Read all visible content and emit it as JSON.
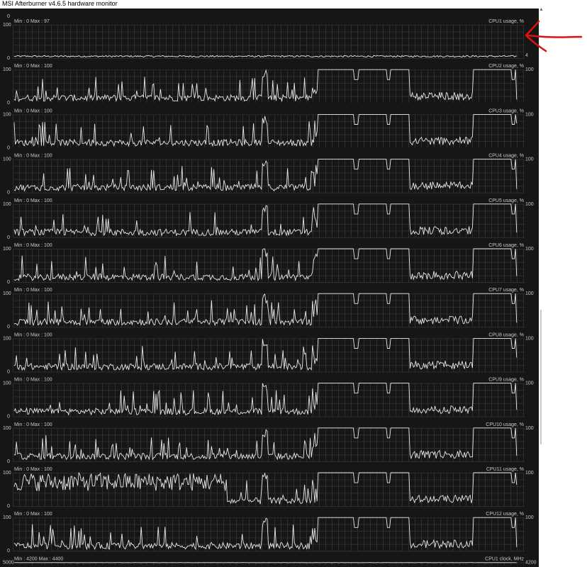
{
  "window": {
    "title": "MSI Afterburner v4.6.5 hardware monitor"
  },
  "colors": {
    "background": "#161616",
    "grid": "#2e2e2e",
    "trace": "#e8e8e8",
    "text": "#c8c8c8",
    "annotation": "#e01010"
  },
  "graphs": [
    {
      "name": "CPU1 usage, %",
      "scale_top": "100",
      "scale_bottom": "0",
      "scale_top_above": "0",
      "minmax": "Min : 0   Max : 97",
      "current": "4",
      "pattern": "flat"
    },
    {
      "name": "CPU2 usage, %",
      "scale_top": "100",
      "scale_bottom": "0",
      "minmax": "Min : 0   Max : 100",
      "current": "100",
      "pattern": "spiky"
    },
    {
      "name": "CPU3 usage, %",
      "scale_top": "100",
      "scale_bottom": "0",
      "minmax": "Min : 0   Max : 100",
      "current": "100",
      "pattern": "spiky"
    },
    {
      "name": "CPU4 usage, %",
      "scale_top": "100",
      "scale_bottom": "0",
      "minmax": "Min : 0   Max : 100",
      "current": "100",
      "pattern": "spiky"
    },
    {
      "name": "CPU5 usage, %",
      "scale_top": "100",
      "scale_bottom": "0",
      "minmax": "Min : 0   Max : 100",
      "current": "100",
      "pattern": "spiky"
    },
    {
      "name": "CPU6 usage, %",
      "scale_top": "100",
      "scale_bottom": "0",
      "minmax": "Min : 0   Max : 100",
      "current": "100",
      "pattern": "spiky"
    },
    {
      "name": "CPU7 usage, %",
      "scale_top": "100",
      "scale_bottom": "0",
      "minmax": "Min : 0   Max : 100",
      "current": "100",
      "pattern": "spiky"
    },
    {
      "name": "CPU8 usage, %",
      "scale_top": "100",
      "scale_bottom": "0",
      "minmax": "Min : 0   Max : 100",
      "current": "100",
      "pattern": "spiky"
    },
    {
      "name": "CPU9 usage, %",
      "scale_top": "100",
      "scale_bottom": "0",
      "minmax": "Min : 0   Max : 100",
      "current": "100",
      "pattern": "spiky"
    },
    {
      "name": "CPU10 usage, %",
      "scale_top": "100",
      "scale_bottom": "0",
      "minmax": "Min : 0   Max : 100",
      "current": "100",
      "pattern": "spiky"
    },
    {
      "name": "CPU11 usage, %",
      "scale_top": "100",
      "scale_bottom": "0",
      "minmax": "Min : 0   Max : 100",
      "current": "100",
      "pattern": "dense"
    },
    {
      "name": "CPU12 usage, %",
      "scale_top": "100",
      "scale_bottom": "0",
      "minmax": "Min : 0   Max : 100",
      "current": "100",
      "pattern": "spiky"
    },
    {
      "name": "CPU1 clock, MHz",
      "scale_top": "5000",
      "scale_bottom": "",
      "minmax": "Min : 4200   Max : 4400",
      "current": "4200",
      "pattern": "clock"
    }
  ]
}
